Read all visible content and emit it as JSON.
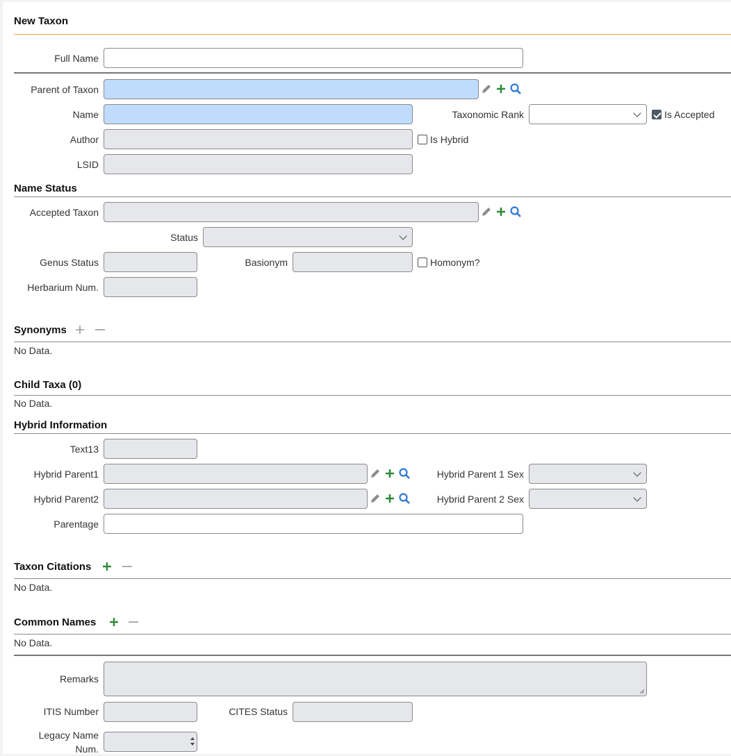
{
  "form_title": "New Taxon",
  "fields": {
    "full_name": {
      "label": "Full Name",
      "value": ""
    },
    "parent_of_taxon": {
      "label": "Parent of Taxon",
      "value": ""
    },
    "name": {
      "label": "Name",
      "value": ""
    },
    "taxonomic_rank": {
      "label": "Taxonomic Rank",
      "value": ""
    },
    "is_accepted": {
      "label": "Is Accepted",
      "checked": true
    },
    "author": {
      "label": "Author",
      "value": ""
    },
    "is_hybrid": {
      "label": "Is Hybrid",
      "checked": false
    },
    "lsid": {
      "label": "LSID",
      "value": ""
    }
  },
  "name_status": {
    "title": "Name Status",
    "accepted_taxon": {
      "label": "Accepted Taxon",
      "value": ""
    },
    "status": {
      "label": "Status",
      "value": ""
    },
    "genus_status": {
      "label": "Genus Status",
      "value": ""
    },
    "basionym": {
      "label": "Basionym",
      "value": ""
    },
    "homonym": {
      "label": "Homonym?",
      "checked": false
    },
    "herbarium_num": {
      "label": "Herbarium Num.",
      "value": ""
    }
  },
  "synonyms": {
    "title": "Synonyms",
    "empty": "No Data."
  },
  "child_taxa": {
    "title": "Child Taxa (0)",
    "empty": "No Data."
  },
  "hybrid_info": {
    "title": "Hybrid Information",
    "text13": {
      "label": "Text13",
      "value": ""
    },
    "hybrid_parent1": {
      "label": "Hybrid Parent1",
      "value": ""
    },
    "hybrid_parent1_sex": {
      "label": "Hybrid Parent 1 Sex",
      "value": ""
    },
    "hybrid_parent2": {
      "label": "Hybrid Parent2",
      "value": ""
    },
    "hybrid_parent2_sex": {
      "label": "Hybrid Parent 2 Sex",
      "value": ""
    },
    "parentage": {
      "label": "Parentage",
      "value": ""
    }
  },
  "taxon_citations": {
    "title": "Taxon Citations",
    "empty": "No Data."
  },
  "common_names": {
    "title": "Common Names",
    "empty": "No Data."
  },
  "bottom": {
    "remarks": {
      "label": "Remarks",
      "value": ""
    },
    "itis_number": {
      "label": "ITIS Number",
      "value": ""
    },
    "cites_status": {
      "label": "CITES Status",
      "value": ""
    },
    "legacy_name_num": {
      "label": "Legacy Name Num.",
      "value": ""
    }
  },
  "icons": {
    "edit": "pencil-icon",
    "add": "plus-icon",
    "search": "magnifier-icon",
    "remove": "minus-icon"
  },
  "colors": {
    "accent_orange": "#f0a048",
    "required_blue": "#bfdcfc",
    "add_green": "#2f8a3a",
    "search_blue": "#2b78d6"
  }
}
